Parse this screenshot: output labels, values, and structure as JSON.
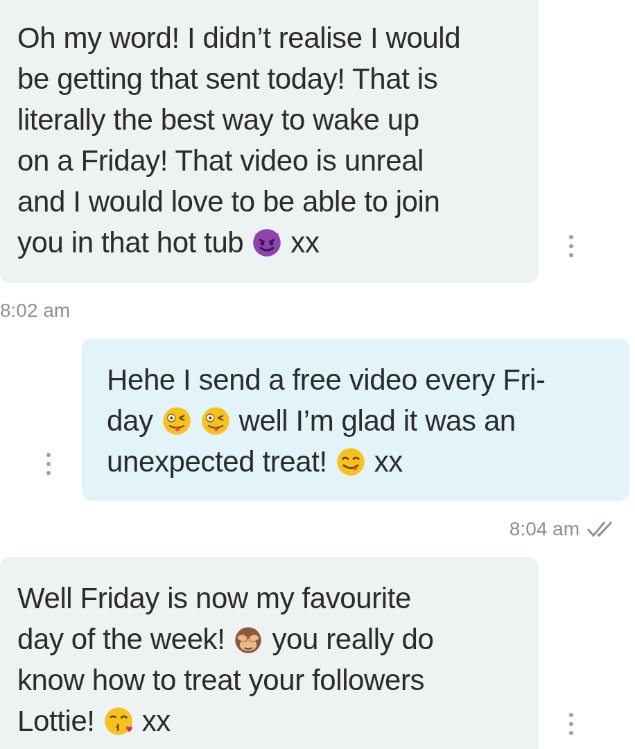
{
  "messages": [
    {
      "kind": "received",
      "lines": [
        [
          {
            "text": "Oh my word! I didn’t realise I would"
          }
        ],
        [
          {
            "text": "be getting that sent today! That is"
          }
        ],
        [
          {
            "text": "literally the best way to wake up"
          }
        ],
        [
          {
            "text": "on a Friday! That video is unreal"
          }
        ],
        [
          {
            "text": "and I would love to be able to join"
          }
        ],
        [
          {
            "text": "you in that hot tub"
          },
          {
            "kind": "emoji"
          },
          {
            "text": "xx"
          }
        ]
      ],
      "time": "8:02 am"
    },
    {
      "kind": "sent",
      "lines": [
        [
          {
            "text": "Hehe I send a free video every Fri-"
          }
        ],
        [
          {
            "text": "day"
          },
          {
            "kind": "emoji"
          },
          {
            "kind": "emoji"
          },
          {
            "text": "well I’m glad it was an"
          }
        ],
        [
          {
            "text": "unexpected treat!"
          },
          {
            "kind": "emoji"
          },
          {
            "text": "xx"
          }
        ]
      ],
      "time": "8:04 am",
      "read": true
    },
    {
      "kind": "received",
      "lines": [
        [
          {
            "text": "Well Friday is now my favourite"
          }
        ],
        [
          {
            "text": "day of the week!"
          },
          {
            "kind": "emoji"
          },
          {
            "text": "you really do"
          }
        ],
        [
          {
            "text": "know how to treat your followers"
          }
        ],
        [
          {
            "text": "Lottie!"
          },
          {
            "kind": "emoji"
          },
          {
            "text": "xx"
          }
        ]
      ]
    }
  ]
}
